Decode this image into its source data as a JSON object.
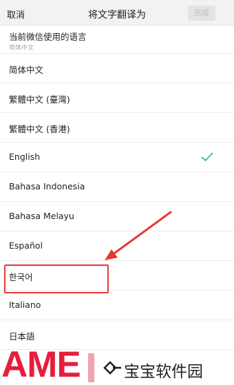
{
  "header": {
    "cancel_label": "取消",
    "title": "将文字翻译为",
    "done_label": "完成"
  },
  "languages": [
    {
      "label": "当前微信使用的语言",
      "sublabel": "简体中文"
    },
    {
      "label": "简体中文"
    },
    {
      "label": "繁體中文 (臺灣)"
    },
    {
      "label": "繁體中文 (香港)"
    },
    {
      "label": "English",
      "selected": true
    },
    {
      "label": "Bahasa Indonesia"
    },
    {
      "label": "Bahasa Melayu"
    },
    {
      "label": "Español"
    },
    {
      "label": "한국어",
      "highlighted": true
    },
    {
      "label": "Italiano"
    },
    {
      "label": "日本語"
    }
  ],
  "watermark": {
    "logo_text": "AME",
    "site_name": "宝宝软件园"
  },
  "colors": {
    "accent_check": "#07c160",
    "annotation_red": "#e53935",
    "logo_red": "#e61e3c"
  },
  "icons": {
    "selected_marker": "checkmark-icon",
    "annotation": "red-arrow"
  }
}
